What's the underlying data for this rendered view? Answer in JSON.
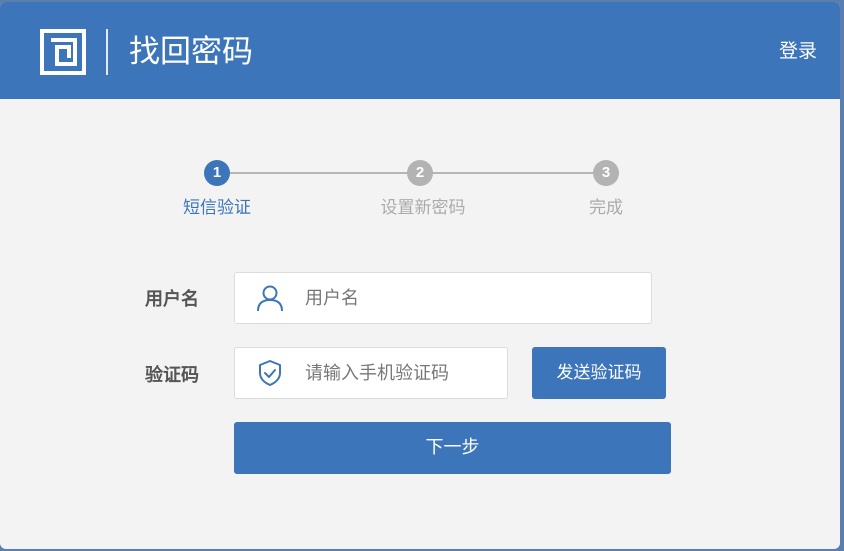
{
  "header": {
    "title": "找回密码",
    "login_link": "登录",
    "logo_icon": "app-logo-icon",
    "bg_color": "#3c75b9"
  },
  "steps": [
    {
      "number": "1",
      "label": "短信验证",
      "active": true
    },
    {
      "number": "2",
      "label": "设置新密码",
      "active": false
    },
    {
      "number": "3",
      "label": "完成",
      "active": false
    }
  ],
  "form": {
    "username": {
      "label": "用户名",
      "placeholder": "用户名",
      "value": "",
      "icon": "user-icon"
    },
    "code": {
      "label": "验证码",
      "placeholder": "请输入手机验证码",
      "value": "",
      "icon": "shield-check-icon"
    },
    "send_code_button": "发送验证码",
    "next_button": "下一步"
  },
  "colors": {
    "accent": "#3c75b9",
    "inactive": "#b3b3b3"
  }
}
